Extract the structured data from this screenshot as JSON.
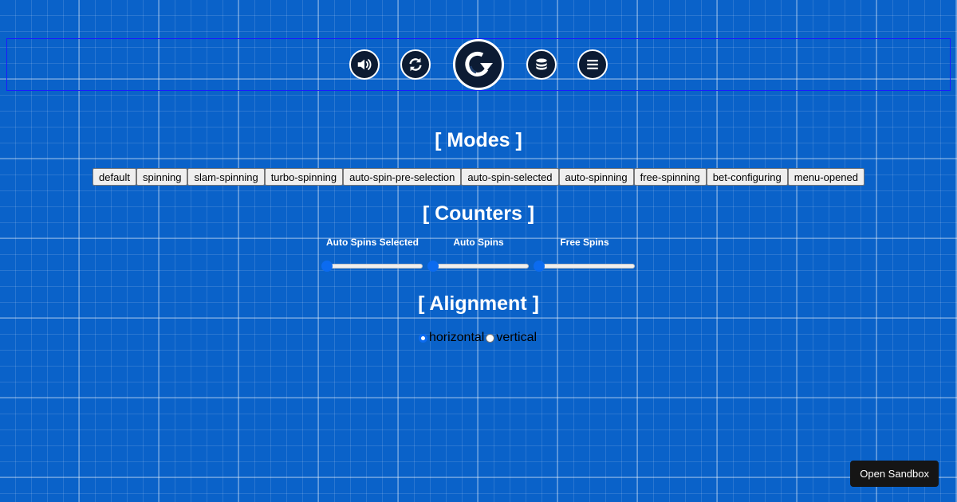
{
  "control_bar": {
    "buttons": [
      {
        "icon": "speaker-icon"
      },
      {
        "icon": "refresh-icon"
      },
      {
        "icon": "spin-icon"
      },
      {
        "icon": "coins-icon"
      },
      {
        "icon": "menu-icon"
      }
    ]
  },
  "modes": {
    "title": "[ Modes ]",
    "buttons": [
      "default",
      "spinning",
      "slam-spinning",
      "turbo-spinning",
      "auto-spin-pre-selection",
      "auto-spin-selected",
      "auto-spinning",
      "free-spinning",
      "bet-configuring",
      "menu-opened"
    ]
  },
  "counters": {
    "title": "[ Counters ]",
    "sliders": [
      {
        "label": "Auto Spins Selected",
        "value": 0
      },
      {
        "label": "Auto Spins",
        "value": 0
      },
      {
        "label": "Free Spins",
        "value": 0
      }
    ]
  },
  "alignment": {
    "title": "[ Alignment ]",
    "options": [
      {
        "label": "horizontal",
        "selected": true
      },
      {
        "label": "vertical",
        "selected": false
      }
    ]
  },
  "sandbox": {
    "label": "Open Sandbox"
  },
  "colors": {
    "background": "#0a62c9",
    "control_button_bg": "#0c1b33",
    "accent": "#0b6bf0",
    "sandbox_button_bg": "#151515"
  }
}
